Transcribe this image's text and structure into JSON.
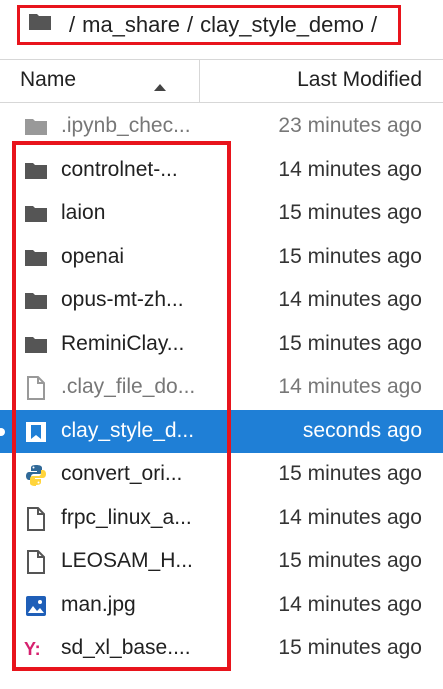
{
  "breadcrumb": {
    "icon": "folder-icon",
    "parts": [
      "/",
      "ma_share",
      "/",
      "clay_style_demo",
      "/"
    ]
  },
  "header": {
    "name_label": "Name",
    "sort_icon": "sort-ascending-icon",
    "modified_label": "Last Modified"
  },
  "files": [
    {
      "name": ".ipynb_chec...",
      "modified": "23 minutes ago",
      "icon": "folder-icon",
      "dim": true
    },
    {
      "name": "controlnet-...",
      "modified": "14 minutes ago",
      "icon": "folder-icon"
    },
    {
      "name": "laion",
      "modified": "15 minutes ago",
      "icon": "folder-icon"
    },
    {
      "name": "openai",
      "modified": "15 minutes ago",
      "icon": "folder-icon"
    },
    {
      "name": "opus-mt-zh...",
      "modified": "14 minutes ago",
      "icon": "folder-icon"
    },
    {
      "name": "ReminiClay...",
      "modified": "15 minutes ago",
      "icon": "folder-icon"
    },
    {
      "name": ".clay_file_do...",
      "modified": "14 minutes ago",
      "icon": "file-icon",
      "dim": true
    },
    {
      "name": "clay_style_d...",
      "modified": "seconds ago",
      "icon": "notebook-icon",
      "selected": true
    },
    {
      "name": "convert_ori...",
      "modified": "15 minutes ago",
      "icon": "python-icon"
    },
    {
      "name": "frpc_linux_a...",
      "modified": "14 minutes ago",
      "icon": "file-icon"
    },
    {
      "name": "LEOSAM_H...",
      "modified": "15 minutes ago",
      "icon": "file-icon"
    },
    {
      "name": "man.jpg",
      "modified": "14 minutes ago",
      "icon": "image-icon"
    },
    {
      "name": "sd_xl_base....",
      "modified": "15 minutes ago",
      "icon": "yaml-icon"
    }
  ],
  "colors": {
    "accent": "#1f7fd6",
    "highlight": "#e8141c"
  }
}
